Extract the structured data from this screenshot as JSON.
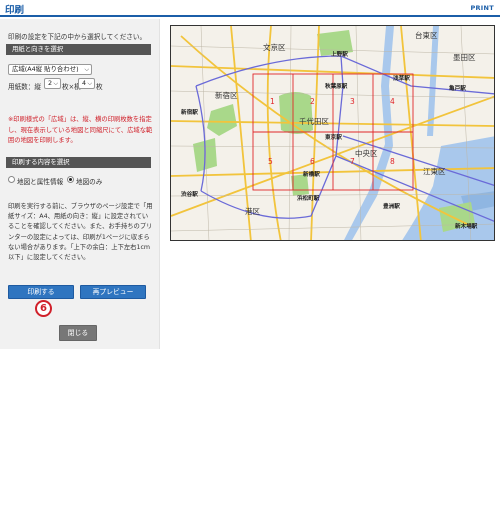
{
  "header": {
    "title": "印刷",
    "print_label": "PRINT"
  },
  "panel": {
    "intro": "印刷の設定を下記の中から選択してください。",
    "section1": "用紙と向きを選択",
    "paper_select": "広域(A4縦 貼り合わせ)",
    "sheets": {
      "prefix": "用紙数：縦",
      "vertical": "2",
      "middle": "枚×横",
      "horizontal": "4",
      "suffix": "枚"
    },
    "note": "※印刷様式の「広域」は、縦、横の印刷枚数を指定し、現在表示している地図と同縮尺にて、広域な範囲の地図を印刷します。",
    "section2": "印刷する内容を選択",
    "radio_map_info": "地図と属性情報",
    "radio_map_only": "地図のみ",
    "info": "印刷を実行する前に、ブラウザのページ設定で「用紙サイズ：A4、用紙の向き：縦」に設定されていることを確認してください。また、お手持ちのプリンターの設定によっては、印刷が1ページに収まらない場合があります。「上下の余白：上下左右1cm以下」に設定してください。",
    "print_button": "印刷する",
    "preview_button": "再プレビュー",
    "marker": "6",
    "close_button": "閉じる"
  },
  "map": {
    "districts": [
      "文京区",
      "新宿区",
      "千代田区",
      "中央区",
      "港区",
      "江東区",
      "台東区",
      "墨田区"
    ],
    "stations": [
      "上野駅",
      "秋葉原駅",
      "浅草駅",
      "亀戸駅",
      "新宿駅",
      "東京駅",
      "新橋駅",
      "渋谷駅",
      "浜松町駅",
      "豊洲駅",
      "新木場駅"
    ],
    "page_numbers": [
      "1",
      "2",
      "3",
      "4",
      "5",
      "6",
      "7",
      "8"
    ],
    "colors": {
      "grid": "#e0262a",
      "rail": "#6a6ad8",
      "road": "#f2c43c",
      "park": "#a9d88a",
      "water": "#a9c8ec"
    }
  }
}
